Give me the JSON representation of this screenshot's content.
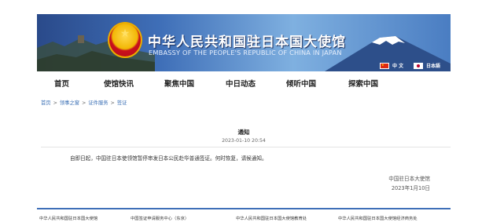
{
  "header": {
    "title_cn": "中华人民共和国驻日本国大使馆",
    "title_en": "EMBASSY OF THE PEOPLE'S REPUBLIC OF CHINA IN JAPAN",
    "lang_cn": "中 文",
    "lang_jp": "日本語"
  },
  "nav": {
    "items": [
      "首页",
      "使馆快讯",
      "聚焦中国",
      "中日动态",
      "倾听中国",
      "探索中国"
    ]
  },
  "breadcrumb": {
    "items": [
      "首页",
      "领事之窗",
      "证件服务",
      "签证"
    ],
    "separator": ">"
  },
  "notice": {
    "title": "通知",
    "date": "2023-01-10 20:54",
    "body": "自即日起，中国驻日本使领馆暂停审发日本公民赴华普通签证。何时恢复，请候通知。",
    "signature_org": "中国驻日本大使馆",
    "signature_date": "2023年1月10日"
  },
  "footer": {
    "links": [
      "中华人民共和国驻日本国大使馆",
      "中国签证申请服务中心（东京）",
      "中华人民共和国驻日本国大使馆教育处",
      "中华人民共和国驻日本国大使馆经济商务处"
    ]
  },
  "colors": {
    "banner_blue": "#3f6fb8",
    "link_blue": "#3a6fb5",
    "flag_red": "#de2910"
  }
}
